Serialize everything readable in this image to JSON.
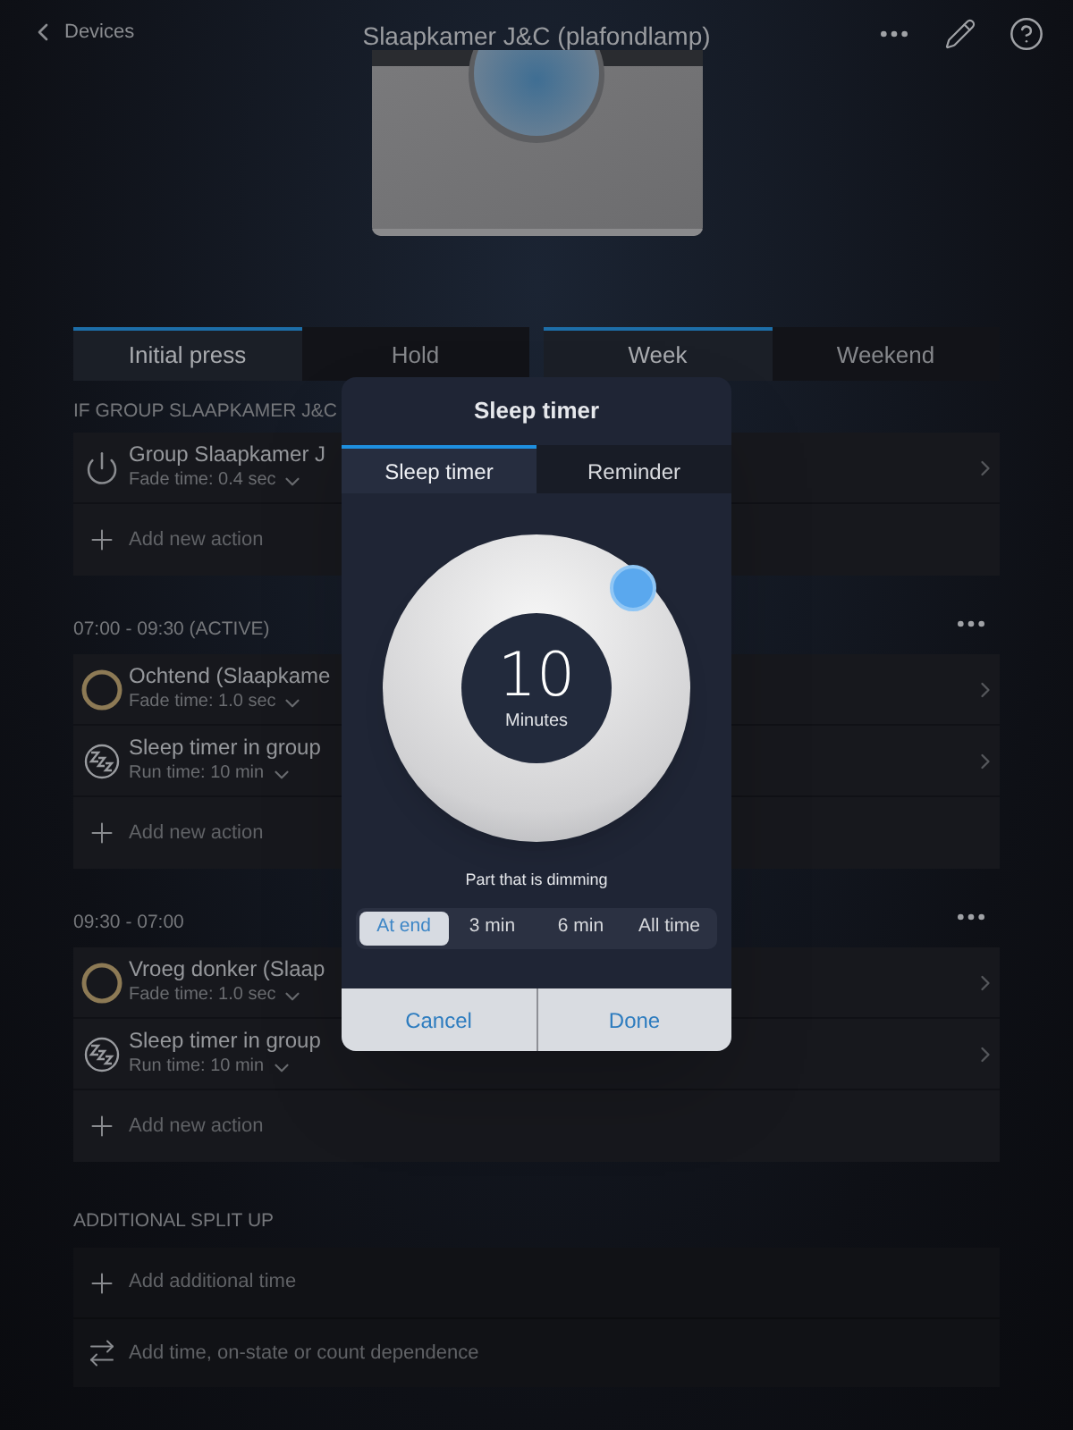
{
  "header": {
    "back": "Devices",
    "title": "Slaapkamer J&C (plafondlamp)"
  },
  "button_tabs": [
    {
      "label": "Initial press",
      "selected": true
    },
    {
      "label": "Hold",
      "selected": false
    }
  ],
  "schedule_tabs": [
    {
      "label": "Week",
      "selected": true
    },
    {
      "label": "Weekend",
      "selected": false
    }
  ],
  "sections": [
    {
      "heading": "IF GROUP SLAAPKAMER J&C",
      "menu": false,
      "add_label": "Add new action",
      "actions": [
        {
          "kind": "power",
          "title": "Group Slaapkamer J",
          "detail": "Fade time: 0.4 sec"
        }
      ]
    },
    {
      "heading": "07:00 - 09:30 (ACTIVE)",
      "menu": true,
      "add_label": "Add new action",
      "actions": [
        {
          "kind": "scene",
          "title": "Ochtend (Slaapkame",
          "detail": "Fade time: 1.0 sec"
        },
        {
          "kind": "sleep",
          "title": "Sleep timer in group",
          "detail": "Run time: 10 min"
        }
      ]
    },
    {
      "heading": "09:30 - 07:00",
      "menu": true,
      "add_label": "Add new action",
      "actions": [
        {
          "kind": "scene",
          "title": "Vroeg donker (Slaap",
          "detail": "Fade time: 1.0 sec"
        },
        {
          "kind": "sleep",
          "title": "Sleep timer in group",
          "detail": "Run time: 10 min"
        }
      ]
    }
  ],
  "additional": {
    "heading": "ADDITIONAL SPLIT UP",
    "items": [
      {
        "kind": "add",
        "label": "Add additional time"
      },
      {
        "kind": "swap",
        "label": "Add time, on-state or count dependence"
      }
    ]
  },
  "dialog": {
    "title": "Sleep timer",
    "tabs": [
      {
        "label": "Sleep timer",
        "selected": true
      },
      {
        "label": "Reminder",
        "selected": false
      }
    ],
    "value": "10",
    "unit": "Minutes",
    "caption": "Part that is dimming",
    "options": [
      {
        "label": "At end",
        "selected": true
      },
      {
        "label": "3 min",
        "selected": false
      },
      {
        "label": "6 min",
        "selected": false
      },
      {
        "label": "All time",
        "selected": false
      }
    ],
    "buttons": [
      "Cancel",
      "Done"
    ]
  }
}
